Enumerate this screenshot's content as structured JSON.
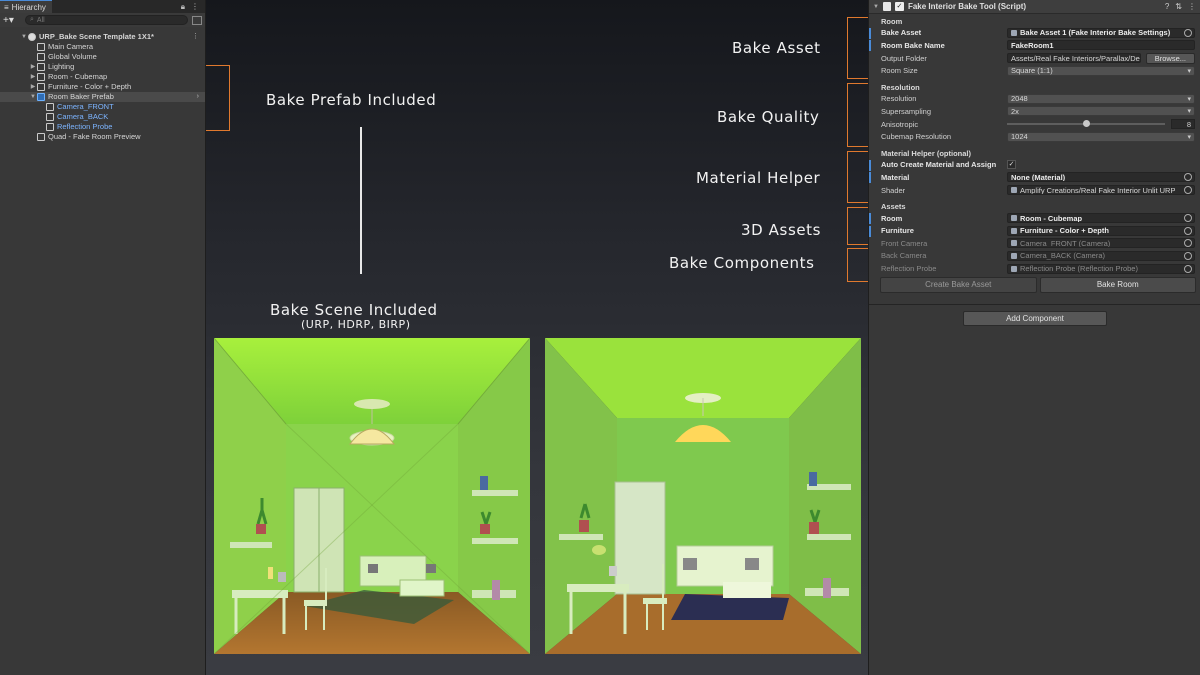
{
  "hierarchy": {
    "tab_label": "Hierarchy",
    "search_placeholder": "All",
    "rows": [
      {
        "label": "URP_Bake Scene Template 1X1*",
        "indent": 0,
        "arrow": "▼",
        "icon": "scene",
        "bold": true,
        "menu": "⋮"
      },
      {
        "label": "Main Camera",
        "indent": 1,
        "arrow": "",
        "icon": "cube"
      },
      {
        "label": "Global Volume",
        "indent": 1,
        "arrow": "",
        "icon": "cube"
      },
      {
        "label": "Lighting",
        "indent": 1,
        "arrow": "▶",
        "icon": "cube"
      },
      {
        "label": "Room - Cubemap",
        "indent": 1,
        "arrow": "▶",
        "icon": "cube"
      },
      {
        "label": "Furniture - Color + Depth",
        "indent": 1,
        "arrow": "▶",
        "icon": "cube"
      },
      {
        "label": "Room Baker Prefab",
        "indent": 1,
        "arrow": "▼",
        "icon": "prefab",
        "selected": true,
        "menu": "›"
      },
      {
        "label": "Camera_FRONT",
        "indent": 2,
        "arrow": "",
        "icon": "cube",
        "blue": true
      },
      {
        "label": "Camera_BACK",
        "indent": 2,
        "arrow": "",
        "icon": "cube",
        "blue": true
      },
      {
        "label": "Reflection Probe",
        "indent": 2,
        "arrow": "",
        "icon": "cube",
        "blue": true
      },
      {
        "label": "Quad - Fake Room Preview",
        "indent": 1,
        "arrow": "",
        "icon": "cube"
      }
    ]
  },
  "callouts": {
    "bake_prefab": "Bake Prefab Included",
    "bake_scene": "Bake Scene Included",
    "bake_scene_sub": "(URP, HDRP, BIRP)",
    "bake_asset": "Bake Asset",
    "bake_quality": "Bake Quality",
    "material_helper": "Material Helper",
    "assets_3d": "3D Assets",
    "bake_components": "Bake Components"
  },
  "inspector": {
    "component_title": "Fake Interior Bake Tool (Script)",
    "room_section": "Room",
    "bake_asset_label": "Bake Asset",
    "bake_asset_value": "Bake Asset 1 (Fake Interior Bake Settings)",
    "room_bake_name_label": "Room Bake Name",
    "room_bake_name_value": "FakeRoom1",
    "output_folder_label": "Output Folder",
    "output_folder_value": "Assets/Real Fake Interiors/Parallax/De",
    "browse_label": "Browse...",
    "room_size_label": "Room Size",
    "room_size_value": "Square (1:1)",
    "resolution_section": "Resolution",
    "resolution_label": "Resolution",
    "resolution_value": "2048",
    "supersampling_label": "Supersampling",
    "supersampling_value": "2x",
    "anisotropic_label": "Anisotropic",
    "anisotropic_value": "8",
    "anisotropic_fraction": 0.5,
    "cubemap_res_label": "Cubemap Resolution",
    "cubemap_res_value": "1024",
    "material_section": "Material Helper (optional)",
    "auto_create_label": "Auto Create Material and Assign",
    "auto_create_checked": "✓",
    "material_label": "Material",
    "material_value": "None (Material)",
    "shader_label": "Shader",
    "shader_value": "Amplify Creations/Real Fake Interior Unlit URP",
    "assets_section": "Assets",
    "room_label": "Room",
    "room_value": "Room - Cubemap",
    "furniture_label": "Furniture",
    "furniture_value": "Furniture - Color + Depth",
    "front_camera_label": "Front Camera",
    "front_camera_value": "Camera_FRONT (Camera)",
    "back_camera_label": "Back Camera",
    "back_camera_value": "Camera_BACK (Camera)",
    "reflection_probe_label": "Reflection Probe",
    "reflection_probe_value": "Reflection Probe (Reflection Probe)",
    "create_bake_asset_label": "Create Bake Asset",
    "bake_room_label": "Bake Room",
    "add_component_label": "Add Component"
  },
  "colors": {
    "accent_orange": "#e0792e",
    "room_green": "#8fd84a",
    "selection_blue": "#4a8bd8"
  }
}
